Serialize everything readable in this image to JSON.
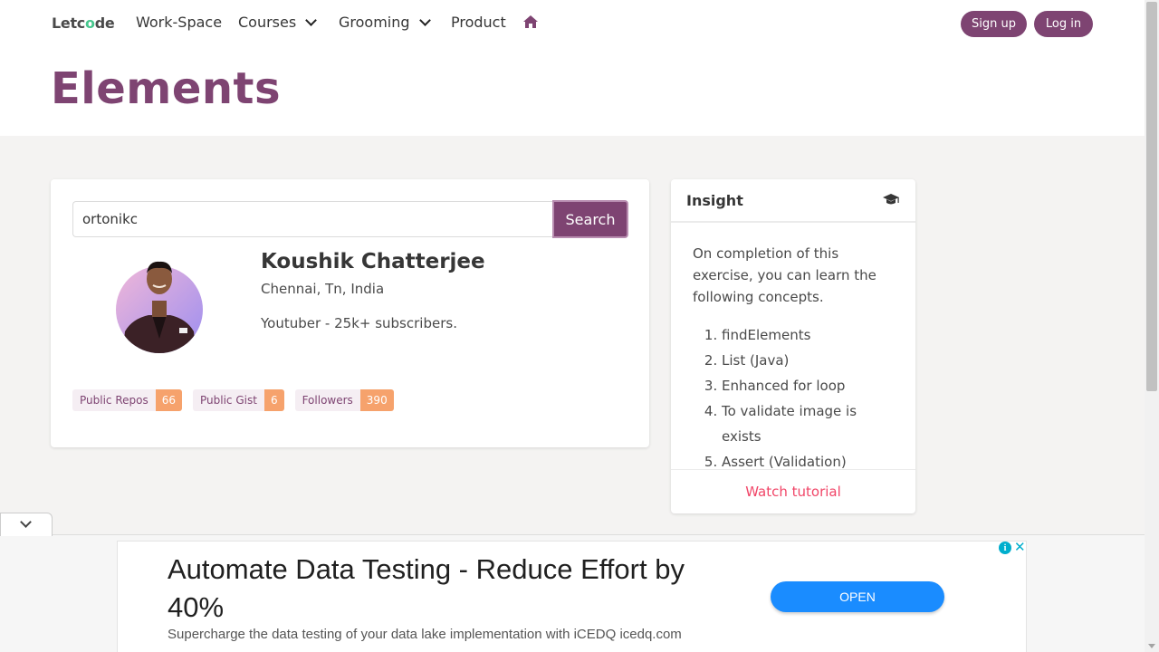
{
  "brand": {
    "logo_prefix": "Letc",
    "logo_mid": "o",
    "logo_suffix": "de"
  },
  "nav": {
    "items": [
      "Work-Space",
      "Courses",
      "Grooming",
      "Product"
    ],
    "signup": "Sign up",
    "login": "Log in"
  },
  "page": {
    "title": "Elements"
  },
  "search": {
    "value": "ortonikc",
    "button": "Search"
  },
  "profile": {
    "name": "Koushik Chatterjee",
    "location": "Chennai, Tn, India",
    "bio": "Youtuber - 25k+ subscribers."
  },
  "stats": [
    {
      "label": "Public Repos",
      "value": "66"
    },
    {
      "label": "Public Gist",
      "value": "6"
    },
    {
      "label": "Followers",
      "value": "390"
    }
  ],
  "insight": {
    "title": "Insight",
    "intro": "On completion of this exercise, you can learn the following concepts.",
    "items": [
      "findElements",
      "List (Java)",
      "Enhanced for loop",
      "To validate image is exists",
      "Assert (Validation)"
    ],
    "footer": "Watch tutorial"
  },
  "ad": {
    "headline": "Automate Data Testing - Reduce Effort by 40%",
    "sub": "Supercharge the data testing of your data lake implementation with iCEDQ icedq.com",
    "cta": "OPEN",
    "info": "i",
    "close": "✕"
  },
  "colors": {
    "accent": "#7e4472",
    "tag_value": "#f6a26c",
    "link": "#f14668",
    "cta": "#1a8cff"
  },
  "icons": [
    "home-icon",
    "chevron-down-icon",
    "graduation-cap-icon",
    "info-icon",
    "close-icon"
  ]
}
